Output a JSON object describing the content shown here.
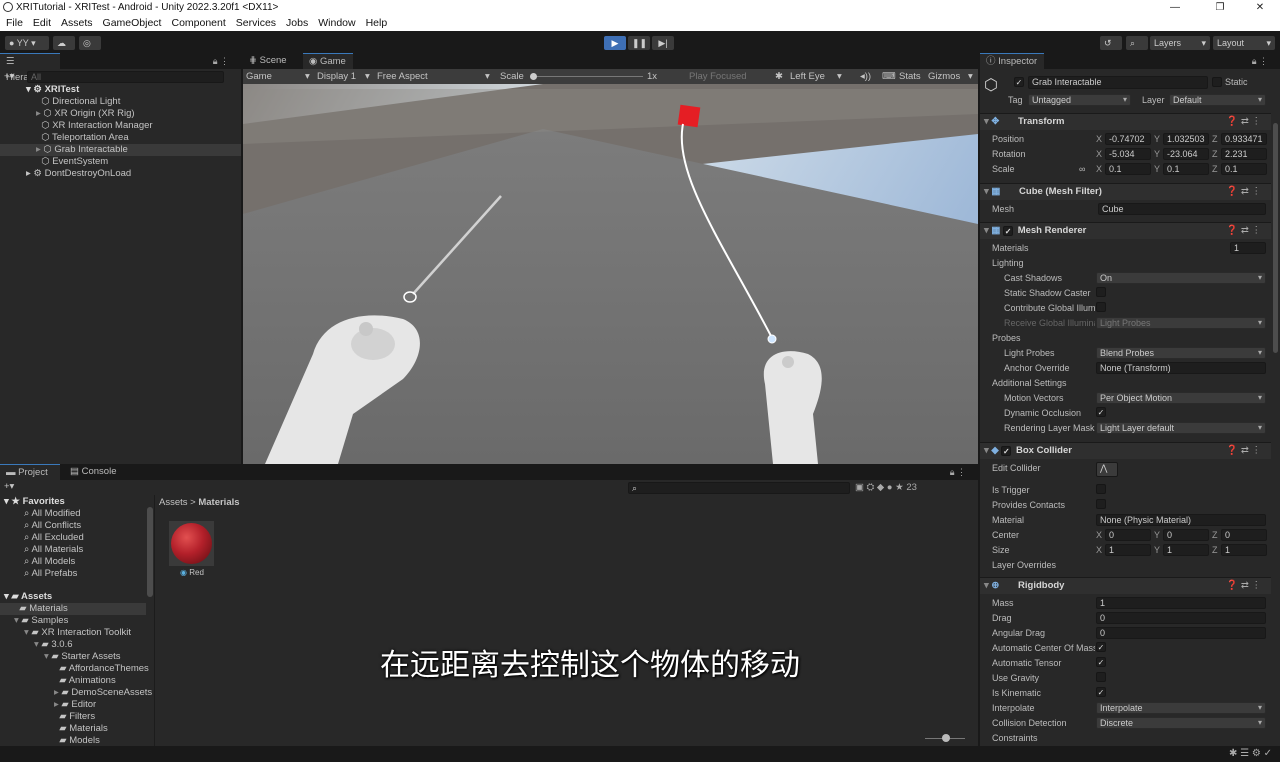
{
  "window": {
    "title": "XRITutorial - XRITest - Android - Unity 2022.3.20f1 <DX11>"
  },
  "menu": [
    "File",
    "Edit",
    "Assets",
    "GameObject",
    "Component",
    "Services",
    "Jobs",
    "Window",
    "Help"
  ],
  "toolbar": {
    "account": "YY",
    "layers": "Layers",
    "layout": "Layout"
  },
  "hierarchy": {
    "tab": "Hierarchy",
    "search_placeholder": "All",
    "scene": "XRITest",
    "items": [
      "Directional Light",
      "XR Origin (XR Rig)",
      "XR Interaction Manager",
      "Teleportation Area",
      "Grab Interactable",
      "EventSystem"
    ],
    "dont_destroy": "DontDestroyOnLoad",
    "selected": "Grab Interactable"
  },
  "game": {
    "tabs": [
      "Scene",
      "Game"
    ],
    "active_tab": "Game",
    "mode": "Game",
    "display": "Display 1",
    "aspect": "Free Aspect",
    "scale_label": "Scale",
    "scale_value": "1x",
    "play_focused": "Play Focused",
    "eye": "Left Eye",
    "stats": "Stats",
    "gizmos": "Gizmos"
  },
  "subtitle": "在远距离去控制这个物体的移动",
  "project": {
    "tabs": [
      "Project",
      "Console"
    ],
    "favorites_label": "Favorites",
    "favorites": [
      "All Modified",
      "All Conflicts",
      "All Excluded",
      "All Materials",
      "All Models",
      "All Prefabs"
    ],
    "assets_label": "Assets",
    "tree": [
      {
        "name": "Materials",
        "depth": 1
      },
      {
        "name": "Samples",
        "depth": 1
      },
      {
        "name": "XR Interaction Toolkit",
        "depth": 2
      },
      {
        "name": "3.0.6",
        "depth": 3
      },
      {
        "name": "Starter Assets",
        "depth": 4
      },
      {
        "name": "AffordanceThemes",
        "depth": 5
      },
      {
        "name": "Animations",
        "depth": 5
      },
      {
        "name": "DemoSceneAssets",
        "depth": 5
      },
      {
        "name": "Editor",
        "depth": 5
      },
      {
        "name": "Filters",
        "depth": 5
      },
      {
        "name": "Materials",
        "depth": 5
      },
      {
        "name": "Models",
        "depth": 5
      }
    ],
    "breadcrumb": [
      "Assets",
      "Materials"
    ],
    "asset": "Red",
    "asset_color": "#b3202a",
    "count": "23"
  },
  "inspector": {
    "tab": "Inspector",
    "object_name": "Grab Interactable",
    "static_label": "Static",
    "tag_label": "Tag",
    "tag": "Untagged",
    "layer_label": "Layer",
    "layer": "Default",
    "transform": {
      "title": "Transform",
      "position_label": "Position",
      "position": [
        "-0.74702",
        "1.032503",
        "0.933471"
      ],
      "rotation_label": "Rotation",
      "rotation": [
        "-5.034",
        "-23.064",
        "2.231"
      ],
      "scale_label": "Scale",
      "scale": [
        "0.1",
        "0.1",
        "0.1"
      ]
    },
    "mesh_filter": {
      "title": "Cube (Mesh Filter)",
      "mesh_label": "Mesh",
      "mesh": "Cube"
    },
    "mesh_renderer": {
      "title": "Mesh Renderer",
      "materials_label": "Materials",
      "materials_count": "1",
      "lighting": "Lighting",
      "cast_shadows_label": "Cast Shadows",
      "cast_shadows": "On",
      "static_shadow_label": "Static Shadow Caster",
      "contribute_gi_label": "Contribute Global Illumination",
      "receive_gi_label": "Receive Global Illumination",
      "receive_gi": "Light Probes",
      "probes": "Probes",
      "light_probes_label": "Light Probes",
      "light_probes": "Blend Probes",
      "anchor_label": "Anchor Override",
      "anchor": "None (Transform)",
      "additional": "Additional Settings",
      "motion_label": "Motion Vectors",
      "motion": "Per Object Motion",
      "dyn_occ_label": "Dynamic Occlusion",
      "rendering_layer_label": "Rendering Layer Mask",
      "rendering_layer": "Light Layer default"
    },
    "box_collider": {
      "title": "Box Collider",
      "edit_label": "Edit Collider",
      "trigger_label": "Is Trigger",
      "contacts_label": "Provides Contacts",
      "material_label": "Material",
      "material": "None (Physic Material)",
      "center_label": "Center",
      "center": [
        "0",
        "0",
        "0"
      ],
      "size_label": "Size",
      "size": [
        "1",
        "1",
        "1"
      ],
      "overrides": "Layer Overrides"
    },
    "rigidbody": {
      "title": "Rigidbody",
      "mass_label": "Mass",
      "mass": "1",
      "drag_label": "Drag",
      "drag": "0",
      "ang_label": "Angular Drag",
      "ang": "0",
      "auto_com_label": "Automatic Center Of Mass",
      "auto_tensor_label": "Automatic Tensor",
      "gravity_label": "Use Gravity",
      "kinematic_label": "Is Kinematic",
      "interp_label": "Interpolate",
      "interp": "Interpolate",
      "coll_label": "Collision Detection",
      "coll": "Discrete",
      "constraints": "Constraints"
    }
  },
  "axes": [
    "X",
    "Y",
    "Z"
  ]
}
